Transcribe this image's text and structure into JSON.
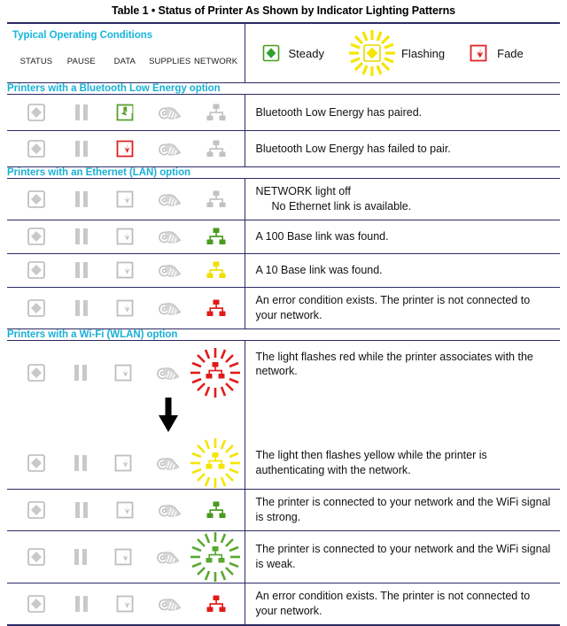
{
  "title": "Table 1 • Status of Printer As Shown by Indicator Lighting Patterns",
  "colors": {
    "heading_teal": "#18b0d7",
    "border_navy": "#2b2b66",
    "icon_gray": "#b3b3b3",
    "green": "#4a9a1e",
    "yellow": "#f5e500",
    "red": "#e01b1b",
    "data_green": "#5aa02c",
    "data_red": "#e02020"
  },
  "legend_header": {
    "label": "Typical Operating Conditions",
    "columns": [
      "STATUS",
      "PAUSE",
      "DATA",
      "SUPPLIES",
      "NETWORK"
    ],
    "items": [
      {
        "icon": "steady-diamond-icon",
        "label": "Steady"
      },
      {
        "icon": "flashing-diamond-icon",
        "label": "Flashing"
      },
      {
        "icon": "fade-box-arrow-icon",
        "label": "Fade"
      }
    ]
  },
  "sections": [
    {
      "heading": "Printers with a Bluetooth Low Energy option",
      "rows": [
        {
          "icons": {
            "status": "gray",
            "pause": "gray",
            "data": "green",
            "supplies": "gray",
            "network": "gray"
          },
          "desc": "Bluetooth Low Energy has paired.",
          "desc2": ""
        },
        {
          "icons": {
            "status": "gray",
            "pause": "gray",
            "data": "red",
            "supplies": "gray",
            "network": "gray"
          },
          "desc": "Bluetooth Low Energy has failed to pair.",
          "desc2": ""
        }
      ]
    },
    {
      "heading": "Printers with an Ethernet (LAN) option",
      "rows": [
        {
          "icons": {
            "status": "gray",
            "pause": "gray",
            "data": "gray",
            "supplies": "gray",
            "network": "gray"
          },
          "desc": "NETWORK light off",
          "desc2": "No Ethernet link is available."
        },
        {
          "icons": {
            "status": "gray",
            "pause": "gray",
            "data": "gray",
            "supplies": "gray",
            "network": "green"
          },
          "desc": "A 100 Base link was found.",
          "desc2": ""
        },
        {
          "icons": {
            "status": "gray",
            "pause": "gray",
            "data": "gray",
            "supplies": "gray",
            "network": "yellow"
          },
          "desc": "A 10 Base link was found.",
          "desc2": ""
        },
        {
          "icons": {
            "status": "gray",
            "pause": "gray",
            "data": "gray",
            "supplies": "gray",
            "network": "red"
          },
          "desc": "An error condition exists. The printer is not connected to your network.",
          "desc2": ""
        }
      ]
    },
    {
      "heading": "Printers with a Wi-Fi (WLAN) option",
      "rows": [
        {
          "icons": {
            "status": "gray",
            "pause": "gray",
            "data": "gray",
            "supplies": "gray",
            "network": "red-flash"
          },
          "desc": "The light flashes red while the printer associates with the network.",
          "desc2": ""
        },
        {
          "icons": {
            "status": "gray",
            "pause": "gray",
            "data": "gray",
            "supplies": "gray",
            "network": "yellow-flash"
          },
          "desc": "The light then flashes yellow while the printer is authenticating with the network.",
          "desc2": ""
        },
        {
          "icons": {
            "status": "gray",
            "pause": "gray",
            "data": "gray",
            "supplies": "gray",
            "network": "green"
          },
          "desc": "The printer is connected to your network and the WiFi signal is strong.",
          "desc2": ""
        },
        {
          "icons": {
            "status": "gray",
            "pause": "gray",
            "data": "gray",
            "supplies": "gray",
            "network": "green-flash"
          },
          "desc": "The printer is connected to your network and the WiFi signal is weak.",
          "desc2": ""
        },
        {
          "icons": {
            "status": "gray",
            "pause": "gray",
            "data": "gray",
            "supplies": "gray",
            "network": "red"
          },
          "desc": "An error condition exists. The printer is not connected to your network.",
          "desc2": ""
        }
      ]
    }
  ]
}
